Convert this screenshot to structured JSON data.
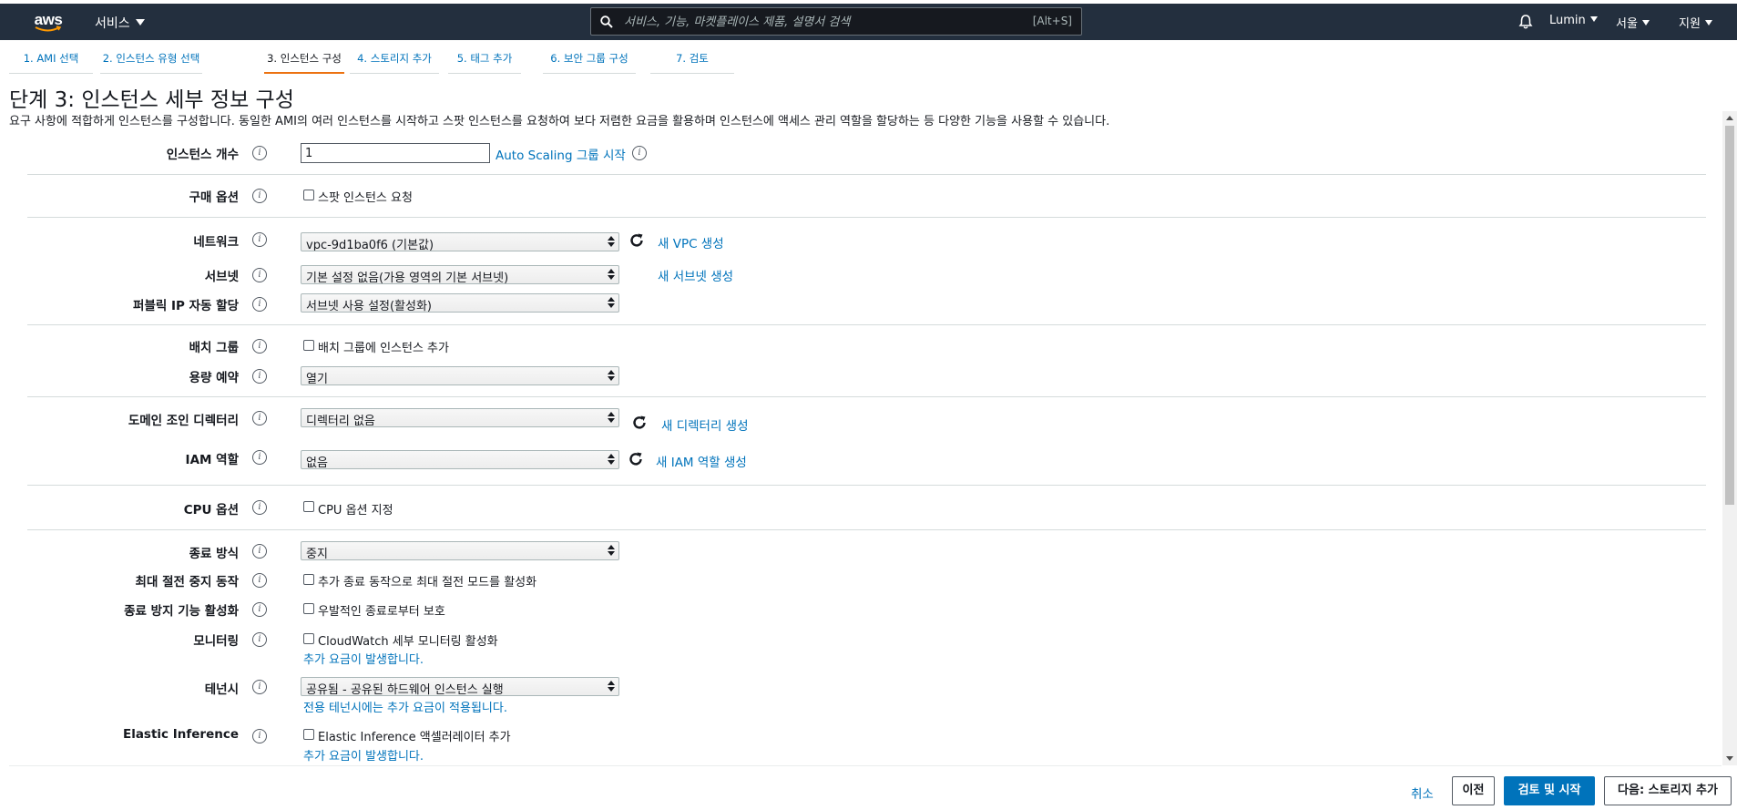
{
  "nav": {
    "logo": "aws",
    "services": "서비스",
    "search_placeholder": "서비스, 기능, 마켓플레이스 제품, 설명서 검색",
    "search_hint": "[Alt+S]",
    "account": "Lumin",
    "region": "서울",
    "support": "지원"
  },
  "wizard": {
    "tabs": [
      {
        "label": "1. AMI 선택"
      },
      {
        "label": "2. 인스턴스 유형 선택"
      },
      {
        "label": "3. 인스턴스 구성"
      },
      {
        "label": "4. 스토리지 추가"
      },
      {
        "label": "5. 태그 추가"
      },
      {
        "label": "6. 보안 그룹 구성"
      },
      {
        "label": "7. 검토"
      }
    ],
    "active_tab": "3. 인스턴스 구성"
  },
  "page": {
    "title": "단계 3: 인스턴스 세부 정보 구성",
    "description": "요구 사항에 적합하게 인스턴스를 구성합니다. 동일한 AMI의 여러 인스턴스를 시작하고 스팟 인스턴스를 요청하여 보다 저렴한 요금을 활용하며 인스턴스에 액세스 관리 역할을 할당하는 등 다양한 기능을 사용할 수 있습니다."
  },
  "form": {
    "instance_count": {
      "label": "인스턴스 개수",
      "value": "1",
      "link": "Auto Scaling 그룹 시작"
    },
    "purchase": {
      "label": "구매 옵션",
      "checkbox": "스팟 인스턴스 요청"
    },
    "network": {
      "label": "네트워크",
      "value": "vpc-9d1ba0f6 (기본값)",
      "link": "새 VPC 생성"
    },
    "subnet": {
      "label": "서브넷",
      "value": "기본 설정 없음(가용 영역의 기본 서브넷)",
      "link": "새 서브넷 생성"
    },
    "public_ip": {
      "label": "퍼블릭 IP 자동 할당",
      "value": "서브넷 사용 설정(활성화)"
    },
    "placement": {
      "label": "배치 그룹",
      "checkbox": "배치 그룹에 인스턴스 추가"
    },
    "capacity": {
      "label": "용량 예약",
      "value": "열기"
    },
    "domain": {
      "label": "도메인 조인 디렉터리",
      "value": "디렉터리 없음",
      "link": "새 디렉터리 생성"
    },
    "iam": {
      "label": "IAM 역할",
      "value": "없음",
      "link": "새 IAM 역할 생성"
    },
    "cpu": {
      "label": "CPU 옵션",
      "checkbox": "CPU 옵션 지정"
    },
    "shutdown": {
      "label": "종료 방식",
      "value": "중지"
    },
    "hibernate": {
      "label": "최대 절전 중지 동작",
      "checkbox": "추가 종료 동작으로 최대 절전 모드를 활성화"
    },
    "termination": {
      "label": "종료 방지 기능 활성화",
      "checkbox": "우발적인 종료로부터 보호"
    },
    "monitoring": {
      "label": "모니터링",
      "checkbox": "CloudWatch 세부 모니터링 활성화",
      "note": "추가 요금이 발생합니다."
    },
    "tenancy": {
      "label": "테넌시",
      "value": "공유됨 - 공유된 하드웨어 인스턴스 실행",
      "note": "전용 테넌시에는 추가 요금이 적용됩니다."
    },
    "inference": {
      "label": "Elastic Inference",
      "checkbox": "Elastic Inference 액셀러레이터 추가",
      "note": "추가 요금이 발생합니다."
    }
  },
  "footer": {
    "cancel": "취소",
    "previous": "이전",
    "review": "검토 및 시작",
    "next": "다음: 스토리지 추가"
  },
  "colors": {
    "nav_bg": "#232f3e",
    "link": "#0073bb",
    "active_tab": "#ec7211",
    "primary_button": "#0073bb"
  }
}
